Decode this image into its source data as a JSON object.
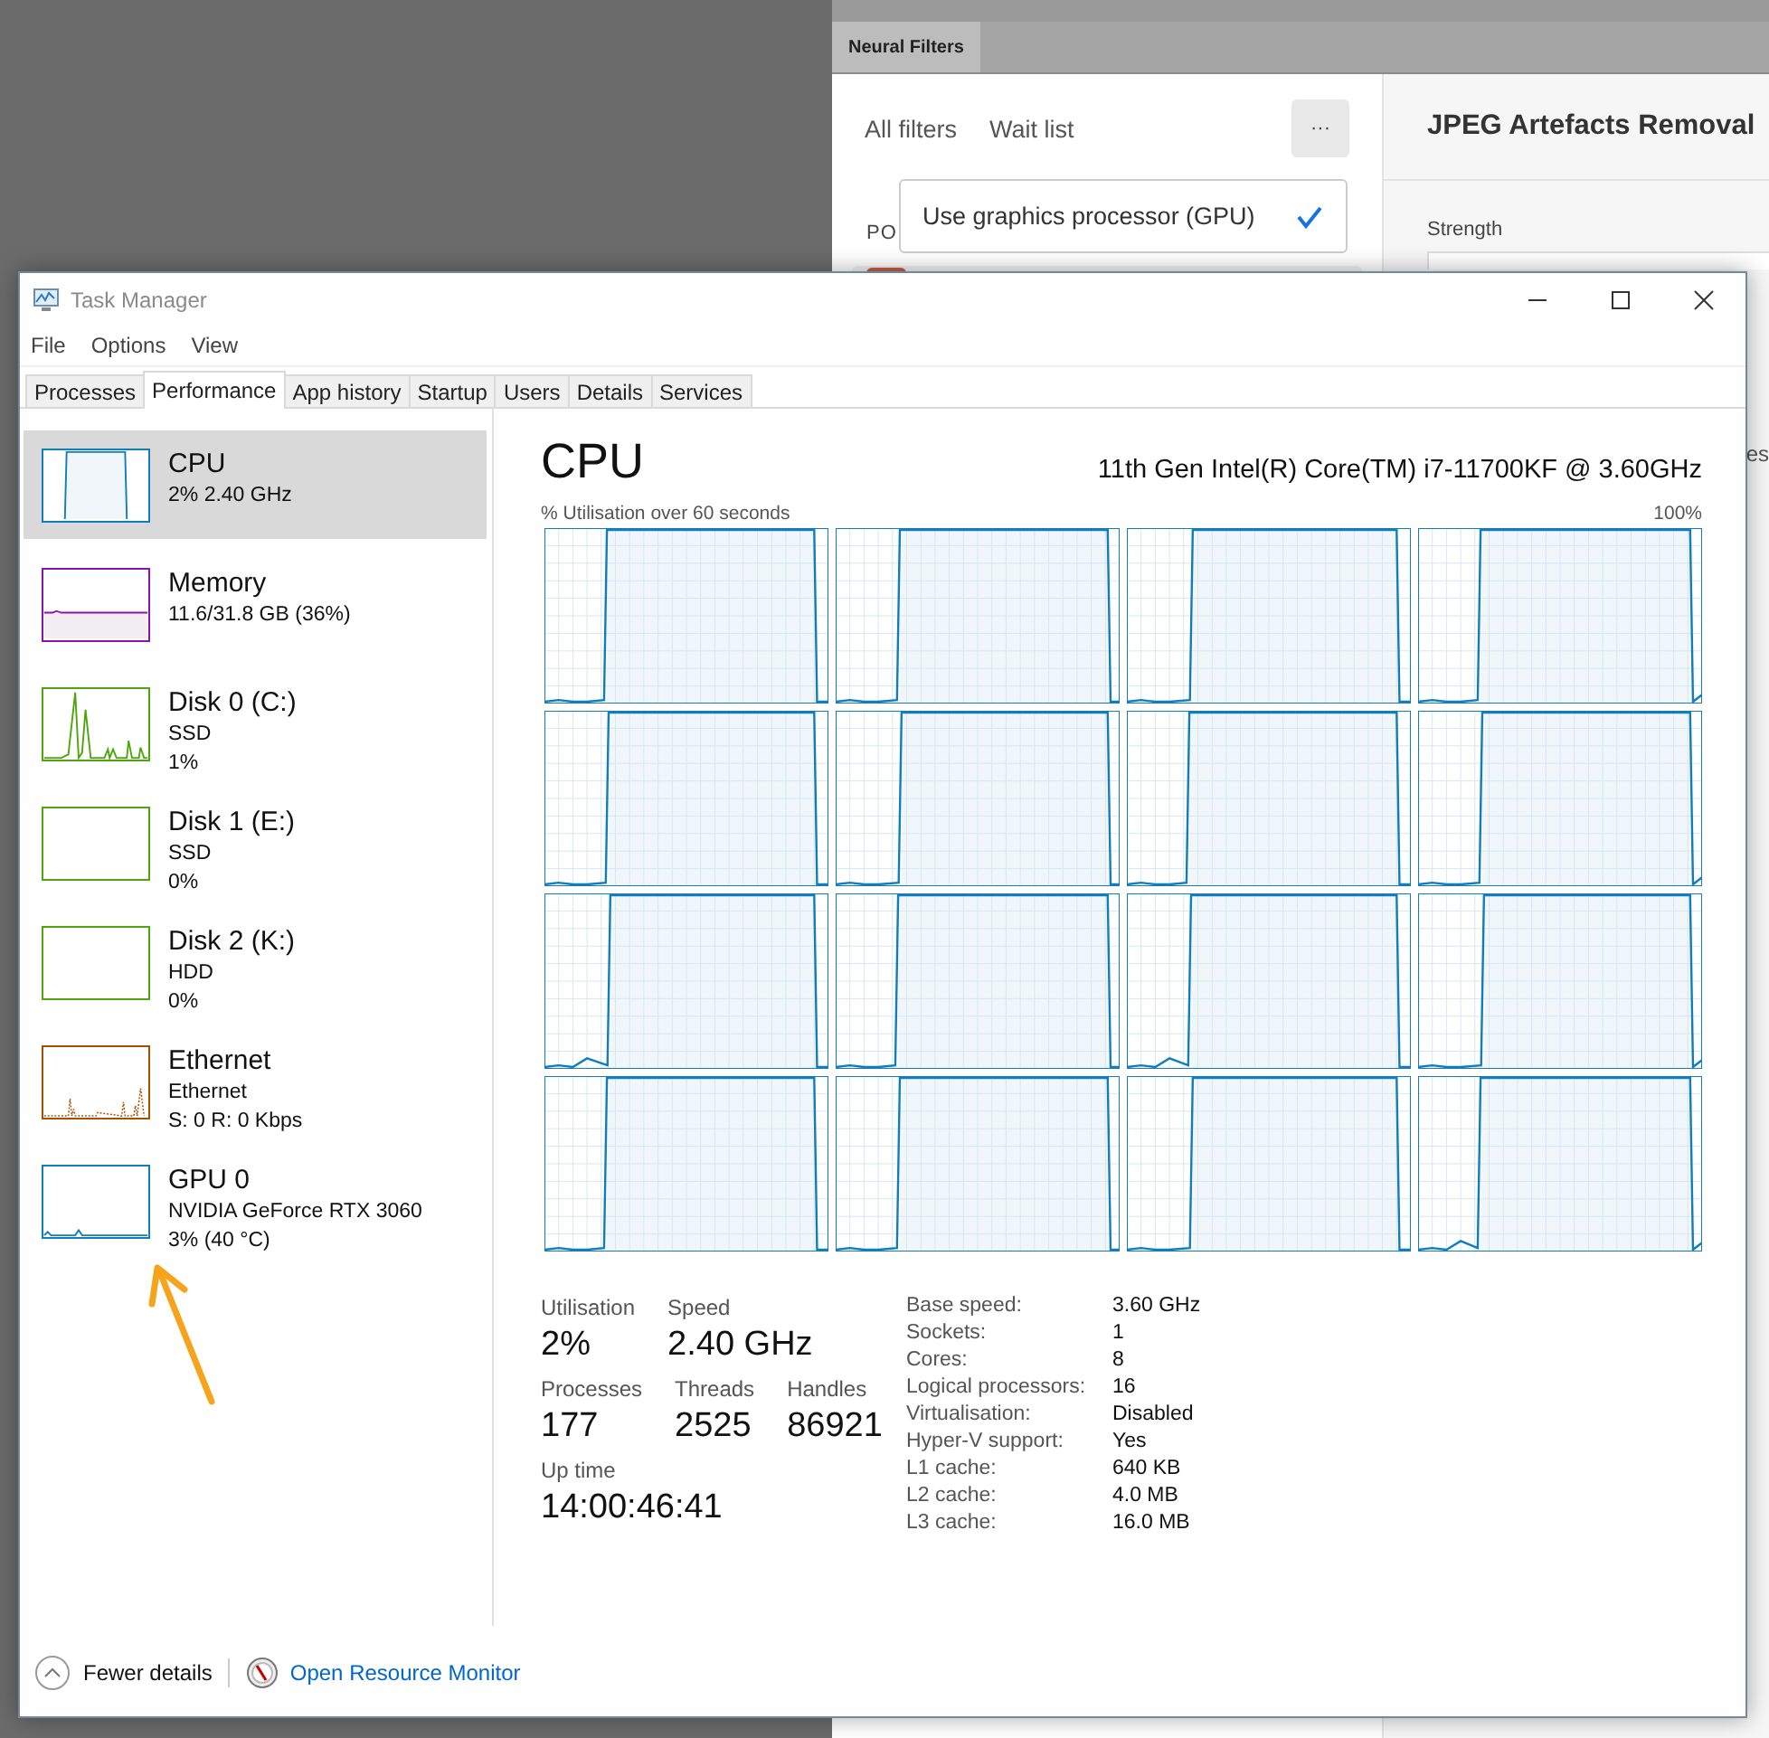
{
  "background_panel": {
    "tab": "Neural Filters",
    "filter_tabs": [
      "All filters",
      "Wait list"
    ],
    "more_button": "···",
    "section_label": "PO",
    "menu": {
      "label": "Use graphics processor (GPU)",
      "checked": true
    },
    "detail_title": "JPEG Artefacts Removal",
    "strength_label": "Strength",
    "edge_fragment": "es"
  },
  "window": {
    "title": "Task Manager"
  },
  "menu": [
    "File",
    "Options",
    "View"
  ],
  "tabs": [
    {
      "label": "Processes",
      "selected": false
    },
    {
      "label": "Performance",
      "selected": true
    },
    {
      "label": "App history",
      "selected": false
    },
    {
      "label": "Startup",
      "selected": false
    },
    {
      "label": "Users",
      "selected": false
    },
    {
      "label": "Details",
      "selected": false
    },
    {
      "label": "Services",
      "selected": false
    }
  ],
  "sidebar": {
    "items": [
      {
        "kind": "cpu",
        "title": "CPU",
        "lines": [
          "2% 2.40 GHz"
        ],
        "color": "#117dbb",
        "selected": true
      },
      {
        "kind": "memory",
        "title": "Memory",
        "lines": [
          "11.6/31.8 GB (36%)"
        ],
        "color": "#8b12ae",
        "selected": false
      },
      {
        "kind": "disk-busy",
        "title": "Disk 0 (C:)",
        "lines": [
          "SSD",
          "1%"
        ],
        "color": "#4da60c",
        "selected": false
      },
      {
        "kind": "disk",
        "title": "Disk 1 (E:)",
        "lines": [
          "SSD",
          "0%"
        ],
        "color": "#4da60c",
        "selected": false
      },
      {
        "kind": "disk",
        "title": "Disk 2 (K:)",
        "lines": [
          "HDD",
          "0%"
        ],
        "color": "#4da60c",
        "selected": false
      },
      {
        "kind": "network",
        "title": "Ethernet",
        "lines": [
          "Ethernet",
          "S: 0 R: 0 Kbps"
        ],
        "color": "#a74f01",
        "selected": false
      },
      {
        "kind": "gpu",
        "title": "GPU 0",
        "lines": [
          "NVIDIA GeForce RTX 3060",
          "3% (40 °C)"
        ],
        "color": "#117dbb",
        "selected": false
      }
    ]
  },
  "main": {
    "title": "CPU",
    "model": "11th Gen Intel(R) Core(TM) i7-11700KF @ 3.60GHz",
    "graph_caption": "% Utilisation over 60 seconds",
    "graph_max": "100%",
    "stats": [
      [
        {
          "label": "Utilisation",
          "value": "2%"
        },
        {
          "label": "Speed",
          "value": "2.40 GHz"
        }
      ],
      [
        {
          "label": "Processes",
          "value": "177"
        },
        {
          "label": "Threads",
          "value": "2525"
        },
        {
          "label": "Handles",
          "value": "86921"
        }
      ],
      [
        {
          "label": "Up time",
          "value": "14:00:46:41"
        }
      ]
    ],
    "specs": [
      {
        "key": "Base speed:",
        "value": "3.60 GHz"
      },
      {
        "key": "Sockets:",
        "value": "1"
      },
      {
        "key": "Cores:",
        "value": "8"
      },
      {
        "key": "Logical processors:",
        "value": "16"
      },
      {
        "key": "Virtualisation:",
        "value": "Disabled"
      },
      {
        "key": "Hyper-V support:",
        "value": "Yes"
      },
      {
        "key": "L1 cache:",
        "value": "640 KB"
      },
      {
        "key": "L2 cache:",
        "value": "4.0 MB"
      },
      {
        "key": "L3 cache:",
        "value": "16.0 MB"
      }
    ]
  },
  "footer": {
    "fewer_details": "Fewer details",
    "link": "Open Resource Monitor"
  }
}
